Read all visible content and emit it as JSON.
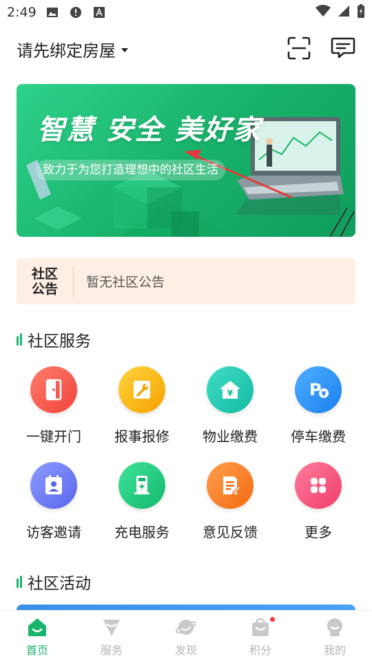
{
  "status_bar": {
    "time": "2:49",
    "icons": [
      "image-icon",
      "alert-icon",
      "a-text-icon",
      "wifi-icon",
      "signal-icon",
      "battery-icon"
    ]
  },
  "header": {
    "house_selector": "请先绑定房屋",
    "scan_icon": "scan-icon",
    "message_icon": "message-icon"
  },
  "banner": {
    "title": "智慧 安全 美好家",
    "subtitle": "致力于为您打造理想中的社区生活"
  },
  "notice": {
    "badge_line1": "社区",
    "badge_line2": "公告",
    "text": "暂无社区公告"
  },
  "sections": {
    "services_title": "社区服务",
    "activities_title": "社区活动"
  },
  "services": [
    {
      "label": "一键开门",
      "icon": "door-icon",
      "color_from": "#ff7d6e",
      "color_to": "#f0433a"
    },
    {
      "label": "报事报修",
      "icon": "wrench-icon",
      "color_from": "#ffd23d",
      "color_to": "#f5a300"
    },
    {
      "label": "物业缴费",
      "icon": "house-yen-icon",
      "color_from": "#3fdcc5",
      "color_to": "#14bba3"
    },
    {
      "label": "停车缴费",
      "icon": "parking-icon",
      "color_from": "#4fb0ff",
      "color_to": "#1a7ff0"
    },
    {
      "label": "访客邀请",
      "icon": "visitor-card-icon",
      "color_from": "#8e9bff",
      "color_to": "#5866ec"
    },
    {
      "label": "充电服务",
      "icon": "charger-icon",
      "color_from": "#3ee29a",
      "color_to": "#14b96b"
    },
    {
      "label": "意见反馈",
      "icon": "feedback-icon",
      "color_from": "#ffa04d",
      "color_to": "#f36a12"
    },
    {
      "label": "更多",
      "icon": "more-icon",
      "color_from": "#ff7d9c",
      "color_to": "#ef3d6a"
    }
  ],
  "bottom_nav": [
    {
      "label": "首页",
      "icon": "home-icon",
      "active": true
    },
    {
      "label": "服务",
      "icon": "service-icon",
      "active": false
    },
    {
      "label": "发现",
      "icon": "planet-icon",
      "active": false
    },
    {
      "label": "积分",
      "icon": "points-bag-icon",
      "active": false,
      "badge": true
    },
    {
      "label": "我的",
      "icon": "profile-icon",
      "active": false
    }
  ],
  "colors": {
    "brand_green": "#1ab56b",
    "notice_bg": "#fdefe4",
    "nav_inactive": "#b5b5b5"
  }
}
